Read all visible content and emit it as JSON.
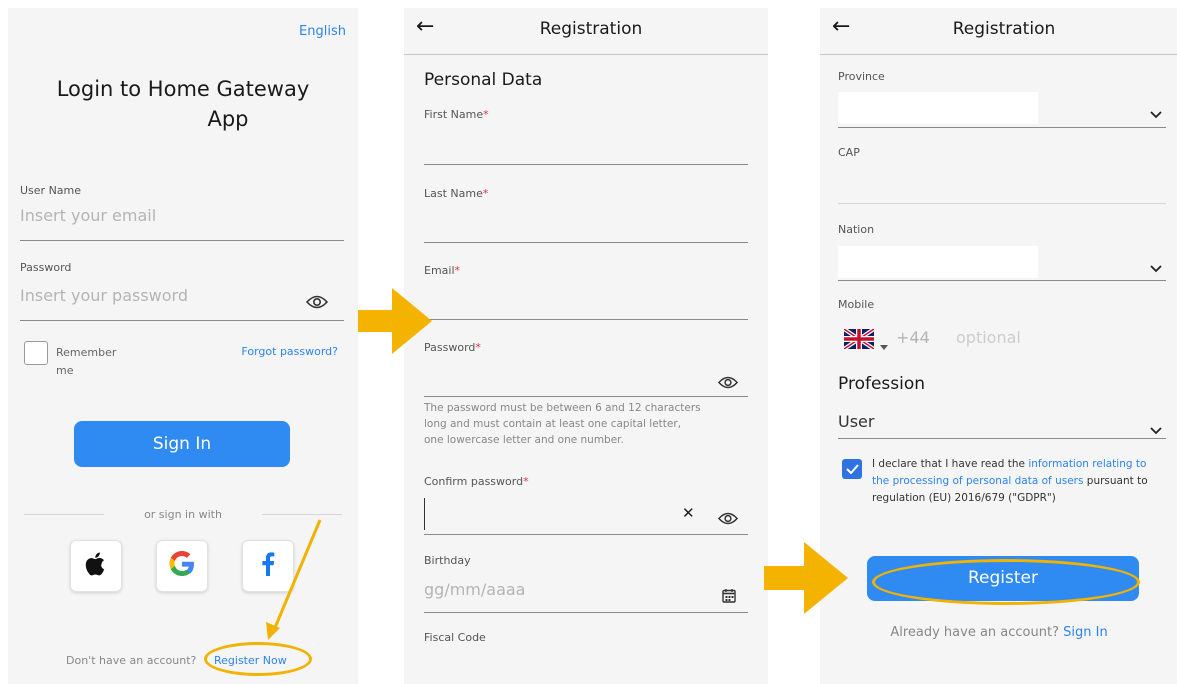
{
  "login": {
    "language": "English",
    "title_line1": "Login to Home Gateway",
    "title_line2": "App",
    "username_label": "User Name",
    "username_placeholder": "Insert your email",
    "password_label": "Password",
    "password_placeholder": "Insert your password",
    "remember_label_line1": "Remember",
    "remember_label_line2": "me",
    "forgot_password": "Forgot password?",
    "sign_in_button": "Sign In",
    "or_sign_in_with": "or sign in with",
    "social": [
      "apple-icon",
      "google-icon",
      "facebook-icon"
    ],
    "no_account_text": "Don't have an account?",
    "register_now": "Register Now"
  },
  "registration": {
    "header_title": "Registration",
    "section_title": "Personal Data",
    "first_name_label": "First Name",
    "last_name_label": "Last Name",
    "email_label": "Email",
    "password_label": "Password",
    "required_mark": "*",
    "password_help_line1": "The password must be between 6 and 12 characters",
    "password_help_line2": "long and must contain at least one capital letter,",
    "password_help_line3": "one lowercase letter and one number.",
    "confirm_password_label": "Confirm password",
    "clear_symbol": "✕",
    "birthday_label": "Birthday",
    "birthday_placeholder": "gg/mm/aaaa",
    "fiscal_code_label": "Fiscal Code"
  },
  "registration2": {
    "header_title": "Registration",
    "province_label": "Province",
    "cap_label": "CAP",
    "nation_label": "Nation",
    "mobile_label": "Mobile",
    "mobile_prefix": "+44",
    "mobile_placeholder": "optional",
    "profession_title": "Profession",
    "profession_value": "User",
    "gdpr_text_1": "I declare that I have read the ",
    "gdpr_link": "information relating to the processing of personal data of users",
    "gdpr_text_2": " pursuant to regulation (EU) 2016/679 (\"GDPR\")",
    "register_button": "Register",
    "have_account_text": "Already have an account?",
    "sign_in_link": "Sign In"
  },
  "colors": {
    "accent": "#2f8af2",
    "link": "#2b84ee",
    "highlight": "#f2b200",
    "required": "#d9363e"
  }
}
